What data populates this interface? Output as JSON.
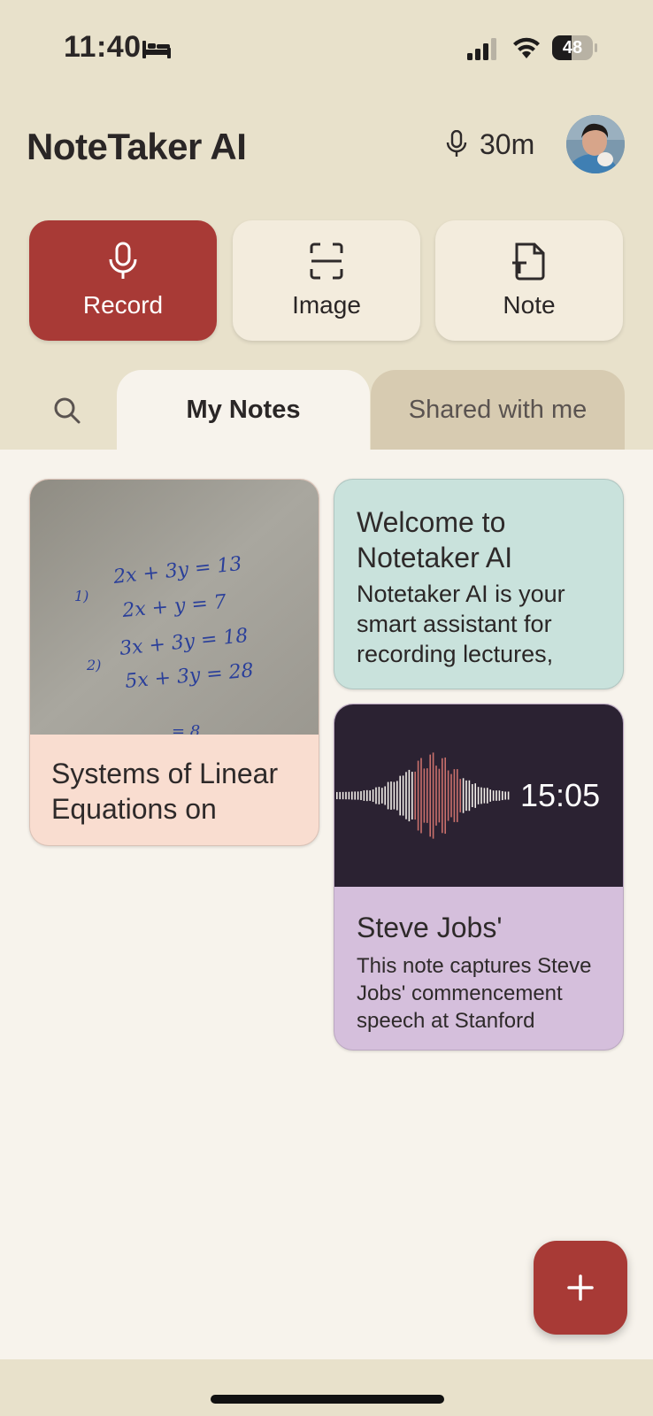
{
  "status_bar": {
    "time": "11:40",
    "battery": "48",
    "battery_level": 0.48
  },
  "header": {
    "title": "NoteTaker AI",
    "recording_minutes": "30m"
  },
  "actions": [
    {
      "label": "Record",
      "icon": "mic-icon"
    },
    {
      "label": "Image",
      "icon": "scan-icon"
    },
    {
      "label": "Note",
      "icon": "text-file-icon"
    }
  ],
  "tabs": {
    "my_notes": "My Notes",
    "shared": "Shared with me",
    "active": "My Notes"
  },
  "notes": [
    {
      "title": "Systems of Linear Equations on",
      "type": "image",
      "photo_equations": [
        "2x + 3y = 13",
        "2x + y = 7",
        "3x + 3y = 18",
        "5x + 3y = 28"
      ],
      "photo_numbers": [
        "1)",
        "2)"
      ],
      "photo_partial": "= 8"
    },
    {
      "title": "Welcome to Notetaker AI",
      "body": "Notetaker AI is your smart assistant for recording lectures,",
      "type": "text"
    },
    {
      "title": "Steve Jobs'",
      "body": "This note captures Steve Jobs' commencement speech at Stanford",
      "duration": "15:05",
      "type": "audio"
    }
  ],
  "fab": {
    "icon": "plus-icon"
  },
  "colors": {
    "accent": "#a83a36",
    "header_bg": "#e8e1cb",
    "page_bg": "#f7f3ec",
    "card_peach": "#f9ddd0",
    "card_mint": "#c9e2dc",
    "card_lavender": "#d5bfdc",
    "audio_bg": "#2b2232"
  }
}
